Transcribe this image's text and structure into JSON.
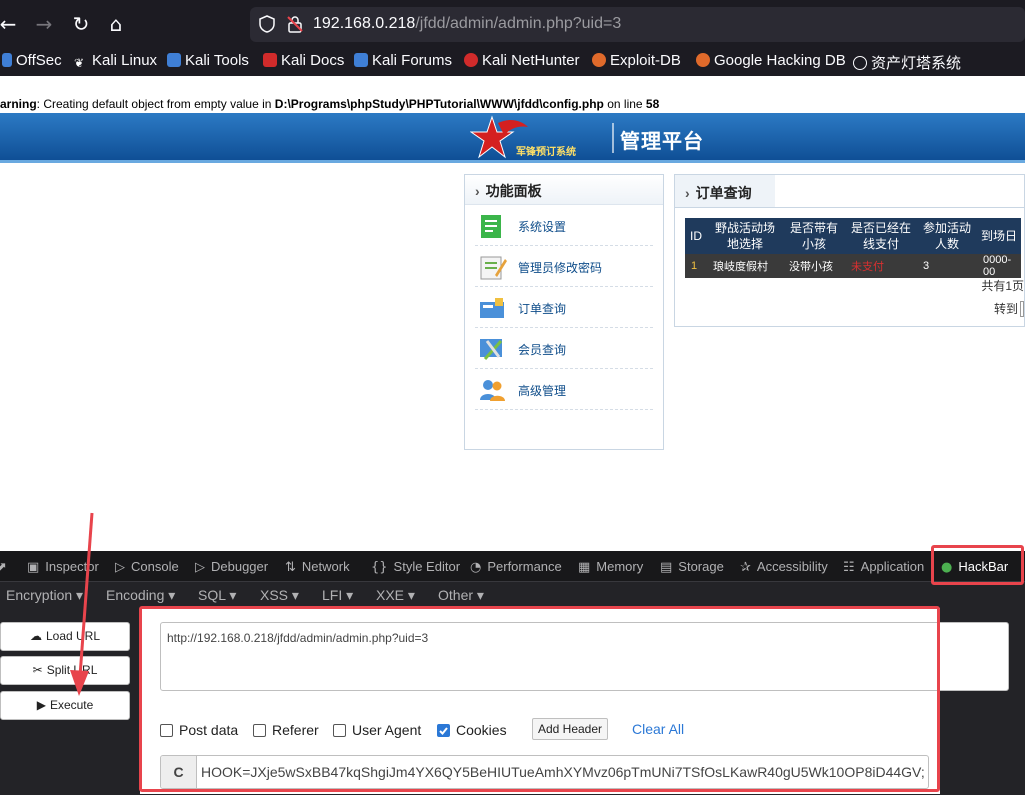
{
  "browser": {
    "url_host": "192.168.0.218",
    "url_path": "/jfdd/admin/admin.php?uid=3",
    "bookmarks": [
      "OffSec",
      "Kali Linux",
      "Kali Tools",
      "Kali Docs",
      "Kali Forums",
      "Kali NetHunter",
      "Exploit-DB",
      "Google Hacking DB",
      "资产灯塔系统"
    ]
  },
  "page": {
    "warning_label": "arning",
    "warning_text": ": Creating default object from empty value in ",
    "warning_path": "D:\\Programs\\phpStudy\\PHPTutorial\\WWW\\jfdd\\config.php",
    "warning_line_text": " on line ",
    "warning_line": "58",
    "logo_text": "军锋预订系统",
    "banner_title": "管理平台",
    "panel_title": "功能面板",
    "menu": [
      "系统设置",
      "管理员修改密码",
      "订单查询",
      "会员查询",
      "高级管理"
    ],
    "order_title": "订单查询",
    "table_headers": [
      [
        "ID"
      ],
      [
        "野战活动场",
        "地选择"
      ],
      [
        "是否带有",
        "小孩"
      ],
      [
        "是否已经在",
        "线支付"
      ],
      [
        "参加活动",
        "人数"
      ],
      [
        "到场日"
      ]
    ],
    "table_row": [
      "1",
      "琅岐度假村",
      "没带小孩",
      "未支付",
      "3",
      "0000-00"
    ],
    "pages_text": "共有1页",
    "goto_text": "转到"
  },
  "devtools": {
    "tabs": [
      "Inspector",
      "Console",
      "Debugger",
      "Network",
      "Style Editor",
      "Performance",
      "Memory",
      "Storage",
      "Accessibility",
      "Application",
      "HackBar"
    ],
    "menus": [
      "Encryption",
      "Encoding",
      "SQL",
      "XSS",
      "LFI",
      "XXE",
      "Other"
    ],
    "buttons": [
      "Load URL",
      "Split URL",
      "Execute"
    ],
    "url_value": "http://192.168.0.218/jfdd/admin/admin.php?uid=3",
    "checks": [
      {
        "label": "Post data",
        "checked": false
      },
      {
        "label": "Referer",
        "checked": false
      },
      {
        "label": "User Agent",
        "checked": false
      },
      {
        "label": "Cookies",
        "checked": true
      }
    ],
    "add_header": "Add Header",
    "clear_all": "Clear All",
    "cookie_label": "C",
    "cookie_value": "HOOK=JXje5wSxBB47kqShgiJm4YX6QY5BeHIUTueAmhXYMvz06pTmUNi7TSfOsLKawR40gU5Wk10OP8iD44GV;"
  },
  "colors": {
    "highlight": "#e8444c",
    "banner": "#1a5ea8",
    "link": "#2b78d6"
  }
}
